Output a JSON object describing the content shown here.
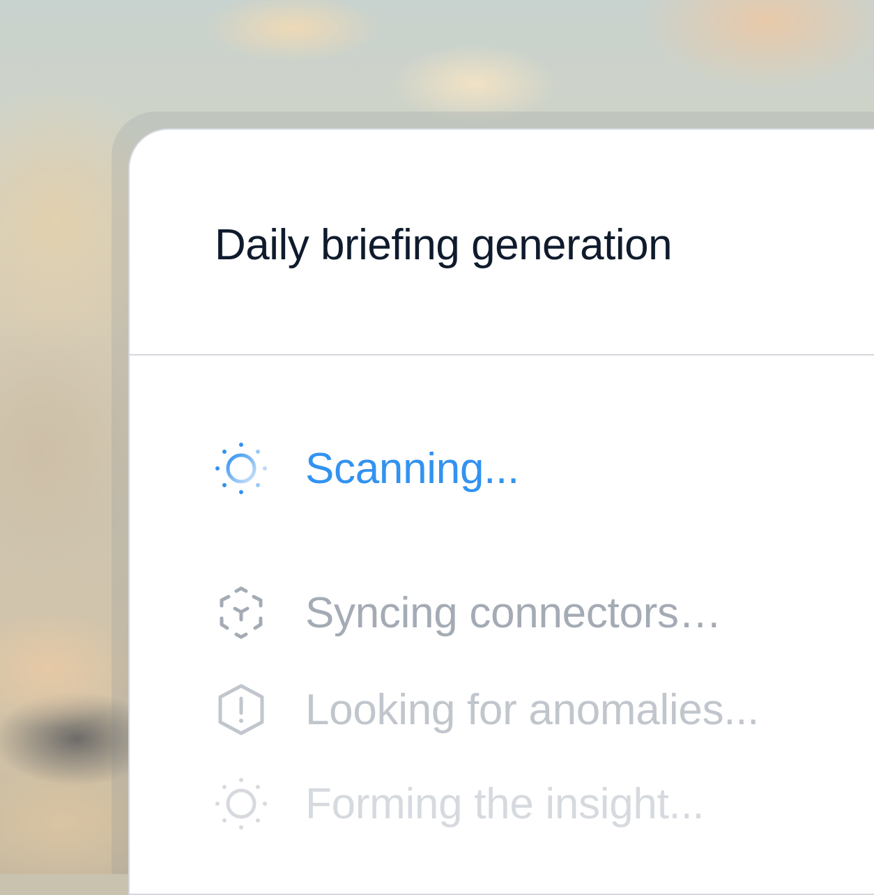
{
  "card": {
    "title": "Daily briefing generation"
  },
  "steps": [
    {
      "label": "Scanning...",
      "icon": "scanning-spinner-icon",
      "state": "active",
      "color": "#3292f0"
    },
    {
      "label": "Syncing connectors…",
      "icon": "sync-cube-icon",
      "state": "pending",
      "color": "#a4abb5"
    },
    {
      "label": "Looking for anomalies...",
      "icon": "alert-hexagon-icon",
      "state": "pending",
      "color": "#c1c6cd"
    },
    {
      "label": "Forming the insight...",
      "icon": "sun-spinner-icon",
      "state": "pending",
      "color": "#d6dadf"
    }
  ]
}
